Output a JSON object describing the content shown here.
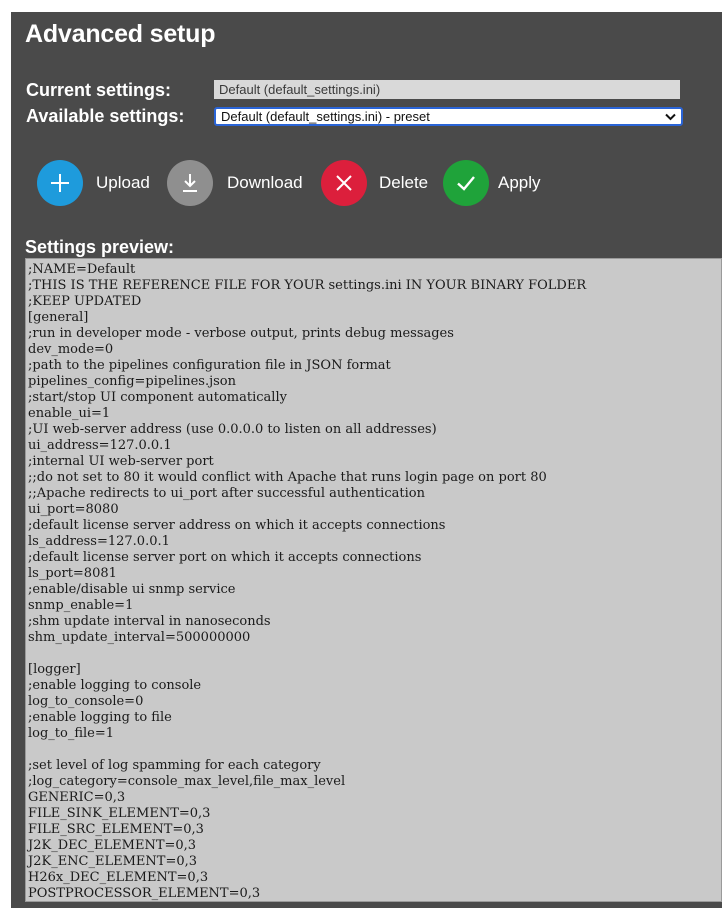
{
  "page": {
    "title": "Advanced setup"
  },
  "current_settings": {
    "label": "Current settings:",
    "value": "Default (default_settings.ini)"
  },
  "available_settings": {
    "label": "Available settings:",
    "selected": "Default (default_settings.ini) - preset",
    "chevron": "⌄"
  },
  "actions": {
    "upload": {
      "label": "Upload",
      "icon": "plus-icon",
      "color": "#1e9bdc"
    },
    "download": {
      "label": "Download",
      "icon": "download-icon",
      "color": "#8f8f8f"
    },
    "delete": {
      "label": "Delete",
      "icon": "close-icon",
      "color": "#dc1f3c"
    },
    "apply": {
      "label": "Apply",
      "icon": "checkmark-icon",
      "color": "#1fa33a"
    }
  },
  "preview": {
    "heading": "Settings preview:",
    "content": ";NAME=Default\n;THIS IS THE REFERENCE FILE FOR YOUR settings.ini IN YOUR BINARY FOLDER\n;KEEP UPDATED\n[general]\n;run in developer mode - verbose output, prints debug messages\ndev_mode=0\n;path to the pipelines configuration file in JSON format\npipelines_config=pipelines.json\n;start/stop UI component automatically\nenable_ui=1\n;UI web-server address (use 0.0.0.0 to listen on all addresses)\nui_address=127.0.0.1\n;internal UI web-server port\n;;do not set to 80 it would conflict with Apache that runs login page on port 80\n;;Apache redirects to ui_port after successful authentication\nui_port=8080\n;default license server address on which it accepts connections\nls_address=127.0.0.1\n;default license server port on which it accepts connections\nls_port=8081\n;enable/disable ui snmp service\nsnmp_enable=1\n;shm update interval in nanoseconds\nshm_update_interval=500000000\n\n[logger]\n;enable logging to console\nlog_to_console=0\n;enable logging to file\nlog_to_file=1\n\n;set level of log spamming for each category\n;log_category=console_max_level,file_max_level\nGENERIC=0,3\nFILE_SINK_ELEMENT=0,3\nFILE_SRC_ELEMENT=0,3\nJ2K_DEC_ELEMENT=0,3\nJ2K_ENC_ELEMENT=0,3\nH26x_DEC_ELEMENT=0,3\nPOSTPROCESSOR_ELEMENT=0,3"
  },
  "colors": {
    "panel_background": "#4a4a4a",
    "preview_background": "#c9c9c9",
    "select_border": "#2a64d6"
  }
}
